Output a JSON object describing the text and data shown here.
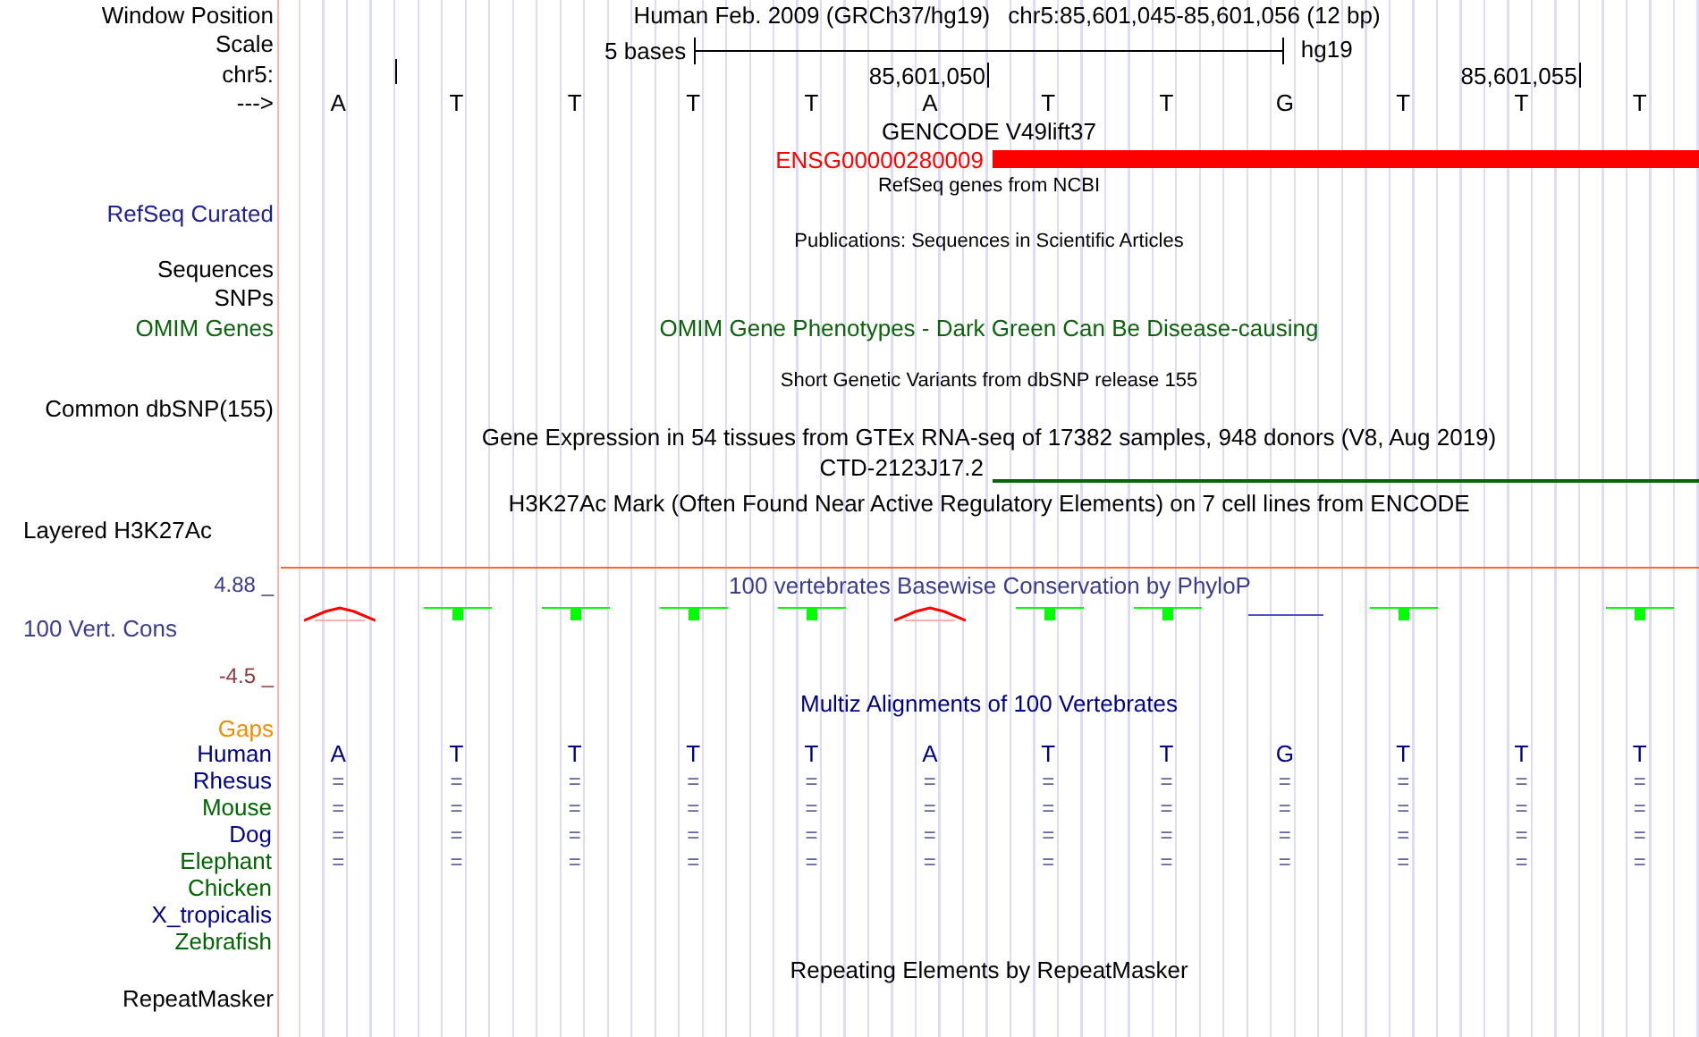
{
  "position": {
    "label": "Window Position",
    "assembly": "Human Feb. 2009 (GRCh37/hg19)",
    "range": "chr5:85,601,045-85,601,056 (12 bp)"
  },
  "scale": {
    "label": "Scale",
    "span": "5 bases",
    "assembly": "hg19"
  },
  "ruler": {
    "label": "chr5:",
    "ticks": [
      "85,601,050",
      "85,601,055"
    ]
  },
  "sequence": {
    "label": "--->",
    "bases": [
      "A",
      "T",
      "T",
      "T",
      "T",
      "A",
      "T",
      "T",
      "G",
      "T",
      "T",
      "T"
    ]
  },
  "gencode": {
    "title": "GENCODE V49lift37",
    "gene": "ENSG00000280009"
  },
  "refseq": {
    "title": "RefSeq genes from NCBI",
    "label": "RefSeq Curated"
  },
  "publications": {
    "title": "Publications: Sequences in Scientific Articles",
    "label": "Sequences"
  },
  "snps": {
    "label": "SNPs"
  },
  "omim": {
    "label": "OMIM Genes",
    "title": "OMIM Gene Phenotypes - Dark Green Can Be Disease-causing"
  },
  "dbsnp": {
    "title": "Short Genetic Variants from dbSNP release 155",
    "label": "Common dbSNP(155)"
  },
  "gtex": {
    "title": "Gene Expression in 54 tissues from GTEx RNA-seq of 17382 samples, 948 donors (V8, Aug 2019)",
    "gene": "CTD-2123J17.2"
  },
  "h3k27ac": {
    "title": "H3K27Ac Mark (Often Found Near Active Regulatory Elements) on 7 cell lines from ENCODE",
    "label": "Layered H3K27Ac"
  },
  "phylop": {
    "title": "100 vertebrates Basewise Conservation by PhyloP",
    "label": "100 Vert. Cons",
    "max": "4.88 _",
    "min": "-4.5 _",
    "bases": [
      {
        "kind": "negative"
      },
      {
        "kind": "positive"
      },
      {
        "kind": "positive"
      },
      {
        "kind": "positive"
      },
      {
        "kind": "positive"
      },
      {
        "kind": "negative"
      },
      {
        "kind": "positive"
      },
      {
        "kind": "positive"
      },
      {
        "kind": "neutral"
      },
      {
        "kind": "positive"
      },
      {
        "kind": "none"
      },
      {
        "kind": "positive"
      }
    ]
  },
  "multiz": {
    "title": "Multiz Alignments of 100 Vertebrates",
    "gaps_label": "Gaps",
    "species": [
      {
        "name": "Human",
        "color": "#000080",
        "kind": "reference",
        "bases": [
          "A",
          "T",
          "T",
          "T",
          "T",
          "A",
          "T",
          "T",
          "G",
          "T",
          "T",
          "T"
        ]
      },
      {
        "name": "Rhesus",
        "color": "#000080",
        "kind": "aligned",
        "bases": [
          "=",
          "=",
          "=",
          "=",
          "=",
          "=",
          "=",
          "=",
          "=",
          "=",
          "=",
          "="
        ]
      },
      {
        "name": "Mouse",
        "color": "#006400",
        "kind": "aligned",
        "bases": [
          "=",
          "=",
          "=",
          "=",
          "=",
          "=",
          "=",
          "=",
          "=",
          "=",
          "=",
          "="
        ]
      },
      {
        "name": "Dog",
        "color": "#000080",
        "kind": "aligned",
        "bases": [
          "=",
          "=",
          "=",
          "=",
          "=",
          "=",
          "=",
          "=",
          "=",
          "=",
          "=",
          "="
        ]
      },
      {
        "name": "Elephant",
        "color": "#006400",
        "kind": "aligned",
        "bases": [
          "=",
          "=",
          "=",
          "=",
          "=",
          "=",
          "=",
          "=",
          "=",
          "=",
          "=",
          "="
        ]
      },
      {
        "name": "Chicken",
        "color": "#006400"
      },
      {
        "name": "X_tropicalis",
        "color": "#000080"
      },
      {
        "name": "Zebrafish",
        "color": "#006400"
      }
    ]
  },
  "repeatmasker": {
    "title": "Repeating Elements by RepeatMasker",
    "label": "RepeatMasker"
  }
}
